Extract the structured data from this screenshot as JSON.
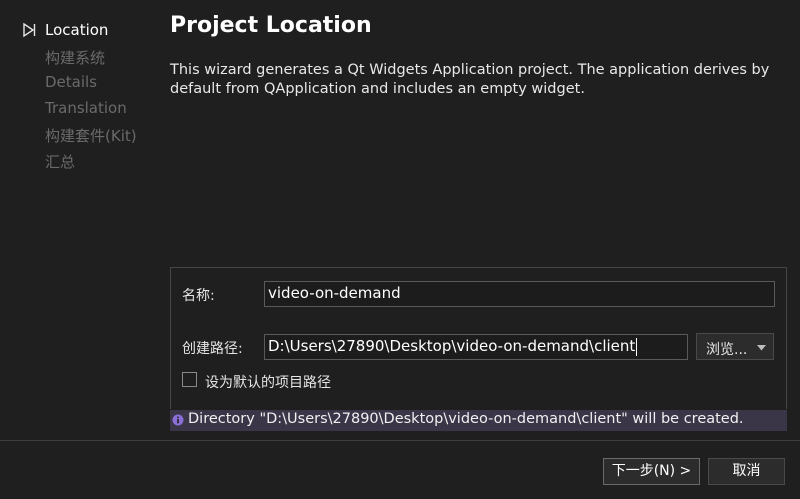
{
  "sidebar": {
    "steps": [
      {
        "label": "Location",
        "current": true
      },
      {
        "label": "构建系统"
      },
      {
        "label": "Details"
      },
      {
        "label": "Translation"
      },
      {
        "label": "构建套件(Kit)"
      },
      {
        "label": "汇总"
      }
    ]
  },
  "page": {
    "title": "Project Location",
    "description": "This wizard generates a Qt Widgets Application project. The application derives by default from QApplication and includes an empty widget."
  },
  "form": {
    "name_label": "名称:",
    "name_value": "video-on-demand",
    "path_label": "创建路径:",
    "path_value": "D:\\Users\\27890\\Desktop\\video-on-demand\\client",
    "browse_label": "浏览...",
    "default_path_label": "设为默认的项目路径",
    "default_path_checked": false
  },
  "info": {
    "icon": "info-icon",
    "text": "Directory \"D:\\Users\\27890\\Desktop\\video-on-demand\\client\" will be created."
  },
  "footer": {
    "next_label": "下一步(N) >",
    "cancel_label": "取消"
  },
  "colors": {
    "background": "#1f1f1f",
    "info_bar": "#3a3547",
    "info_icon": "#8b6fd6"
  }
}
